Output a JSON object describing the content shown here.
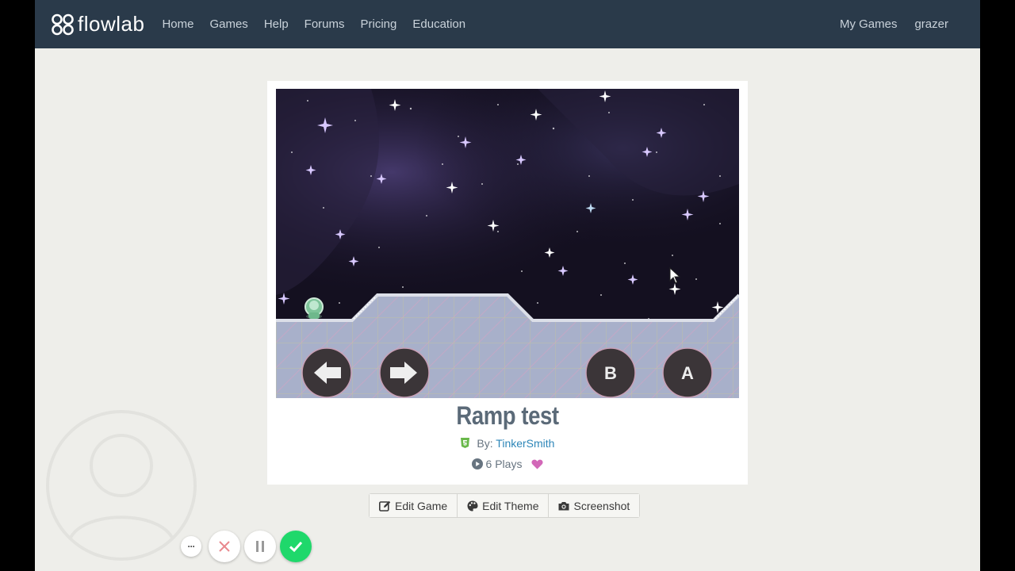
{
  "navbar": {
    "logo_text": "flowlab",
    "links": [
      "Home",
      "Games",
      "Help",
      "Forums",
      "Pricing",
      "Education"
    ],
    "right_links": [
      "My Games",
      "grazer"
    ]
  },
  "game": {
    "title": "Ramp test",
    "by_label": "By:",
    "author": "TinkerSmith",
    "plays": "6 Plays",
    "buttons": {
      "b": "B",
      "a": "A"
    }
  },
  "toolbar": {
    "edit_game": "Edit Game",
    "edit_theme": "Edit Theme",
    "screenshot": "Screenshot"
  },
  "recorder": {
    "more": "···"
  },
  "colors": {
    "navbar_bg": "#2a3a4a",
    "page_bg": "#eeeeea",
    "link_blue": "#2d86b8",
    "heart": "#d268b8",
    "record_done": "#1fd86b",
    "ground": "#a6aec8"
  }
}
